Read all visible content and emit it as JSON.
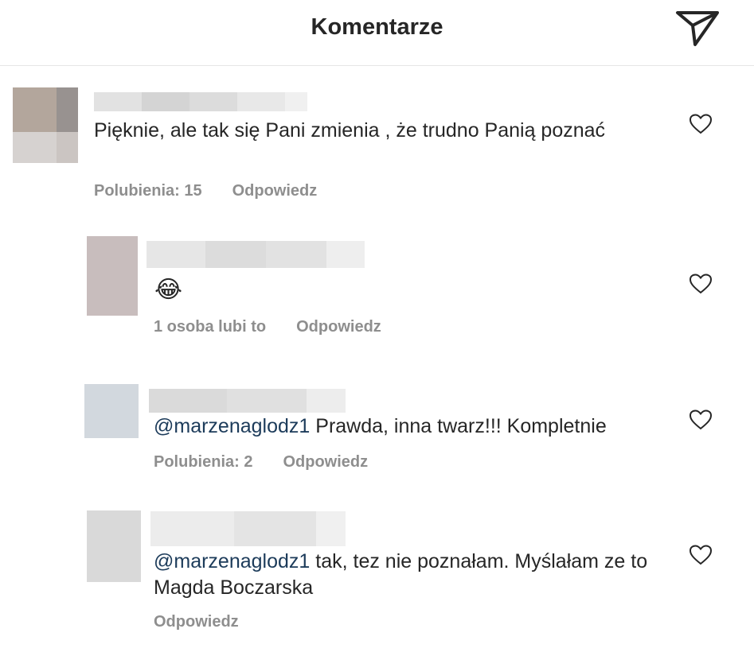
{
  "header": {
    "title": "Komentarze",
    "send_icon": "paper-plane-icon"
  },
  "comments": [
    {
      "text": "Pięknie, ale tak się Pani zmienia , że trudno Panią poznać",
      "likes": "Polubienia: 15",
      "reply": "Odpowiedz"
    },
    {
      "emoji": "😂",
      "likes": "1 osoba lubi to",
      "reply": "Odpowiedz"
    },
    {
      "mention": "@marzenaglodz1",
      "text": " Prawda, inna twarz!!! Kompletnie",
      "likes": "Polubienia: 2",
      "reply": "Odpowiedz"
    },
    {
      "mention": "@marzenaglodz1",
      "text": " tak, tez nie poznałam. Myślałam ze to Magda Boczarska",
      "reply": "Odpowiedz"
    }
  ],
  "icons": {
    "heart": "heart-outline-icon",
    "send": "paper-plane-icon"
  },
  "colors": {
    "text": "#262626",
    "meta": "#8e8e8e",
    "mention": "#1c3b5a",
    "divider": "#e6e6e6"
  }
}
